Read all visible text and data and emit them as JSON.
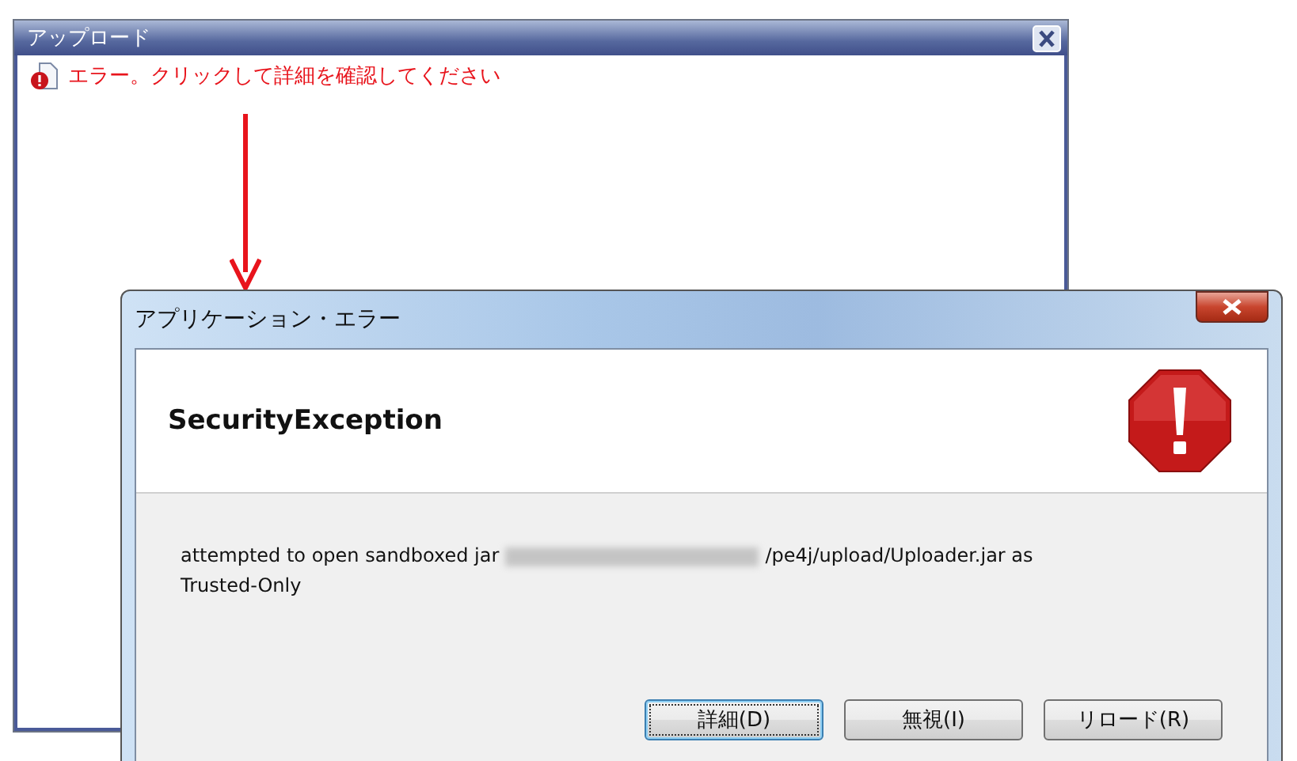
{
  "upload_window": {
    "title": "アップロード",
    "status_message": "エラー。クリックして詳細を確認してください"
  },
  "dialog": {
    "title": "アプリケーション・エラー",
    "heading": "SecurityException",
    "message_start": "attempted to open sandboxed jar",
    "message_end": "/pe4j/upload/Uploader.jar as",
    "message_continued": "Trusted-Only",
    "buttons": [
      {
        "label": "詳細(D)",
        "default": true
      },
      {
        "label": "無視(I)",
        "default": false
      },
      {
        "label": "リロード(R)",
        "default": false
      }
    ]
  }
}
